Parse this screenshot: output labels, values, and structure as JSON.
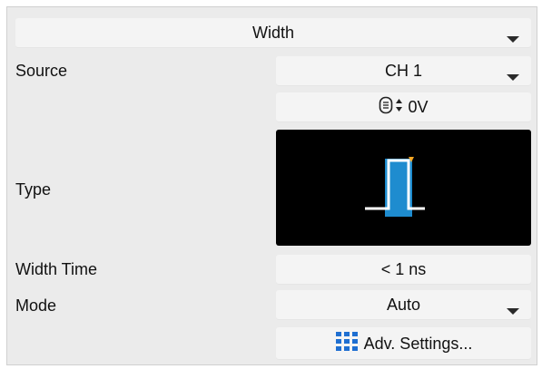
{
  "trigger": {
    "title": "Width",
    "source": {
      "label": "Source",
      "value": "CH 1"
    },
    "level": {
      "value": "0V",
      "icon": "level-knob-icon"
    },
    "type": {
      "label": "Type",
      "icon": "pulse-width-icon"
    },
    "width_time": {
      "label": "Width Time",
      "value": "< 1 ns"
    },
    "mode": {
      "label": "Mode",
      "value": "Auto"
    },
    "adv_settings": {
      "label": "Adv. Settings...",
      "icon": "grid-icon"
    }
  },
  "colors": {
    "background": "#ebebeb",
    "control": "#f4f4f4",
    "pulse_blue": "#1e8ccf",
    "pulse_line": "#ffffff",
    "trigger_marker": "#f5a623",
    "grid_icon": "#1f6fd1"
  }
}
